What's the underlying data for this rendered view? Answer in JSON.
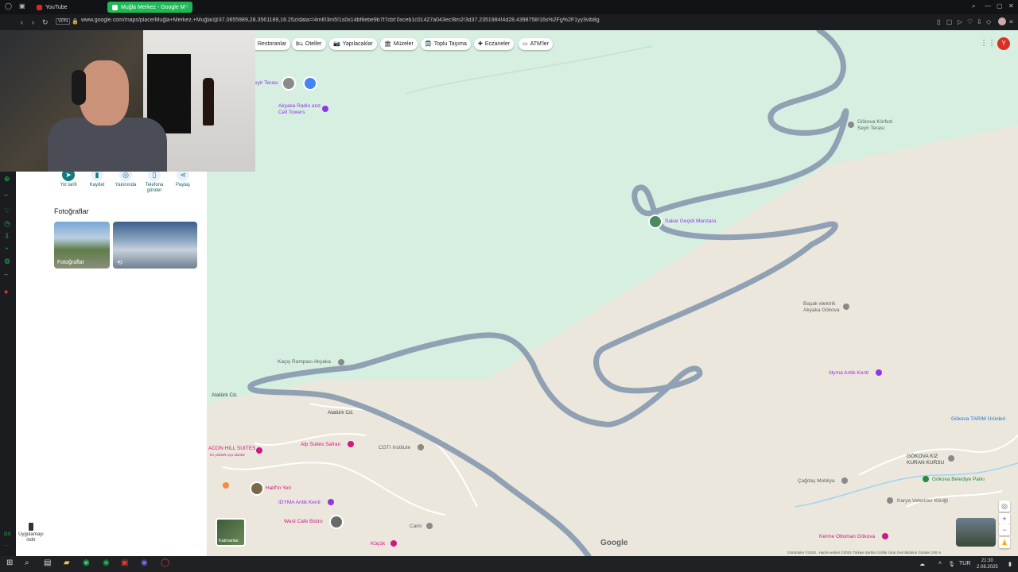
{
  "browser": {
    "tabs": [
      {
        "label": "YouTube"
      },
      {
        "label": "Muğla Merkez - Google M"
      }
    ],
    "url": "www.google.com/maps/place/Muğla+Merkez,+Muğla/@37.0655989,28.3561189,16.25z/data=!4m6!3m5!1s0x14bf6ebe9b7f7cbf:0xceb1c01427a043ec!8m2!3d37.2351984!4d28.4398758!16s%2Fg%2F1yy3vlb8g",
    "vpn": "VPN"
  },
  "categories": [
    {
      "label": "Restoranlar",
      "icon": "fork-icon"
    },
    {
      "label": "Oteller",
      "icon": "bed-icon"
    },
    {
      "label": "Yapılacaklar",
      "icon": "camera-icon"
    },
    {
      "label": "Müzeler",
      "icon": "museum-icon"
    },
    {
      "label": "Toplu Taşıma",
      "icon": "bus-icon"
    },
    {
      "label": "Eczaneler",
      "icon": "pharmacy-icon"
    },
    {
      "label": "ATM'ler",
      "icon": "atm-icon"
    }
  ],
  "actions": [
    {
      "label": "Yol tarifi",
      "icon": "directions-icon"
    },
    {
      "label": "Kaydet",
      "icon": "bookmark-icon"
    },
    {
      "label": "Yakınında",
      "icon": "nearby-icon"
    },
    {
      "label": "Telefona gönder",
      "icon": "phone-icon"
    },
    {
      "label": "Paylaş",
      "icon": "share-icon"
    }
  ],
  "photos": {
    "title": "Fotoğraflar",
    "first_label": "Fotoğraflar"
  },
  "app_download": "Uygulamayı indir",
  "map_labels": {
    "seyir_short": "eyir Terası",
    "radio": "Akyaka Radio and Cell Towers",
    "gokova_seyir": "Gökova Körfezi Seyir Terası",
    "sakar": "Sakar Geçidi Manzara",
    "basak": "Başak elektrik Akyaka Gökova",
    "kacis": "Kaçış Rampası Akyaka",
    "idyma_kenti": "Idyma Antik Kenti",
    "ataturk1": "Atatürk Cd.",
    "ataturk2": "Atatürk Cd.",
    "hill": "ACON HILL SUITES",
    "hill_sub": "En yüksek oyu alanlar",
    "alp": "Alp Suites Safran",
    "cgti": "CGTI Institute",
    "halifin": "Halif'in Yeri",
    "idyma2": "IDYMA Antik Kenti",
    "westcafe": "West Cafe Bistro",
    "cami": "Cami",
    "kucuk": "Küçük",
    "gokova_tarim": "Gökova TARIM Ürünleri",
    "kiz_kuran": "GÖKOVA KIZ KURAN KURSU",
    "cagdas": "Çağdaş Mobilya",
    "belediye": "Gökova Belediye Parkı",
    "karya": "Karya Veteriner Kliniği",
    "kerme": "Kerme Ottoman Gökova",
    "road": "D550"
  },
  "layers_label": "Katmanlar",
  "google_logo": "Google",
  "footer": "Görüntüler ©2025 , Harita verileri ©2025   Türkiye   Şartlar   Gizlilik   Ürün Geri Bildirimi Gönder   100 m",
  "avatar": "Y",
  "clock": {
    "time": "21:30",
    "date": "2.08.2025"
  },
  "lang": "TUR",
  "colors": {
    "road": "#8fa1b3",
    "map_green": "#d6efe1",
    "map_beige": "#ece7dc",
    "accent": "#137a7f",
    "active_tab": "#1db954"
  }
}
